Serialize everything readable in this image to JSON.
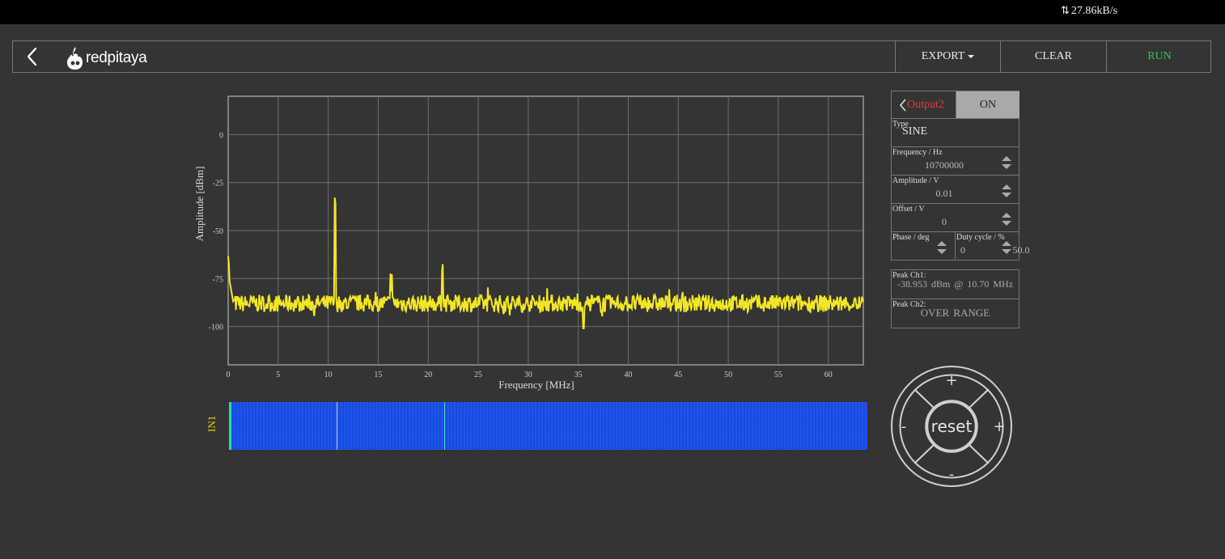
{
  "status_bar": {
    "net_speed": "27.86kB/s"
  },
  "header": {
    "logo_text": "redpitaya",
    "buttons": {
      "export": "EXPORT",
      "clear": "CLEAR",
      "run": "RUN"
    },
    "run_color": "#3cc24a"
  },
  "spectrum": {
    "xlabel": "Frequency [MHz]",
    "ylabel": "Amplitude [dBm]",
    "trace_color": "#f3e625"
  },
  "chart_data": {
    "type": "line",
    "title": "",
    "xlabel": "Frequency [MHz]",
    "ylabel": "Amplitude [dBm]",
    "xlim": [
      0,
      63.5
    ],
    "ylim": [
      -120,
      20
    ],
    "x_ticks": [
      0,
      5,
      10,
      15,
      20,
      25,
      30,
      35,
      40,
      45,
      50,
      55,
      60
    ],
    "y_ticks": [
      0,
      -25,
      -50,
      -75,
      -100
    ],
    "grid": true,
    "series": [
      {
        "noise_floor_dbm": -88,
        "peaks": [
          {
            "x": 0.05,
            "y": -70
          },
          {
            "x": 10.7,
            "y": -39
          },
          {
            "x": 21.4,
            "y": -74
          },
          {
            "x": 16.3,
            "y": -82
          },
          {
            "x": 35.5,
            "y": -101
          }
        ]
      }
    ]
  },
  "waterfall": {
    "channel_label": "IN1",
    "marker_freqs_mhz": [
      10.7,
      21.4
    ]
  },
  "generator": {
    "output_label": "Output2",
    "state_label": "ON",
    "type_label": "Type",
    "type_value": "SINE",
    "frequency_label": "Frequency / Hz",
    "frequency_value": "10700000",
    "amplitude_label": "Amplitude / V",
    "amplitude_value": "0.01",
    "offset_label": "Offset / V",
    "offset_value": "0",
    "phase_label": "Phase / deg",
    "phase_value": "0",
    "duty_label": "Duty cycle / %",
    "duty_value": "50.0"
  },
  "peaks": {
    "ch1_label": "Peak Ch1:",
    "ch1_value": "-38.953 dBm @ 10.70 MHz",
    "ch2_label": "Peak Ch2:",
    "ch2_value": "OVER RANGE"
  },
  "dpad": {
    "reset_label": "reset",
    "up_label": "+",
    "down_label": "-",
    "left_label": "-",
    "right_label": "+"
  }
}
